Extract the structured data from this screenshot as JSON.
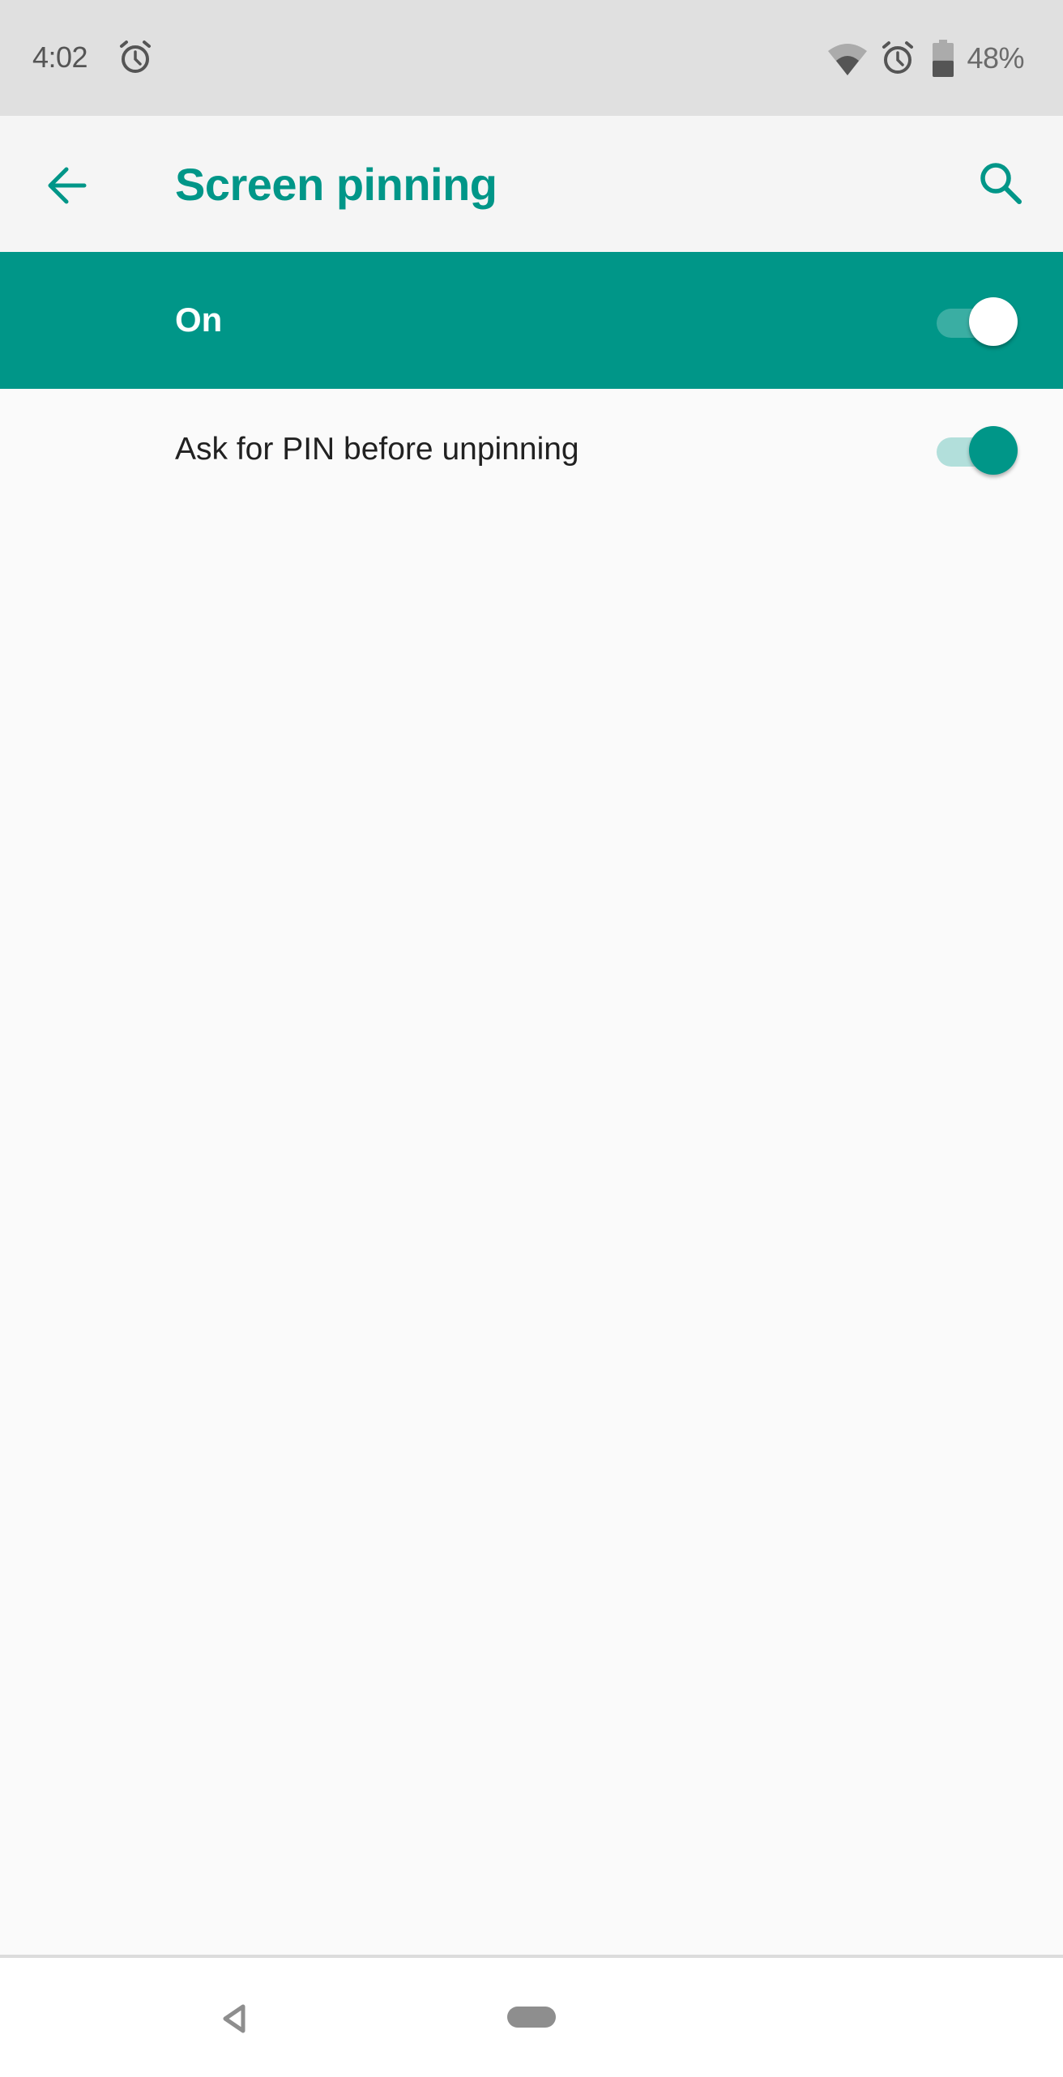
{
  "status_bar": {
    "time": "4:02",
    "left_icons": [
      "alarm-icon"
    ],
    "right_icons": [
      "wifi-icon",
      "alarm-icon",
      "battery-icon"
    ],
    "battery_percent": "48%",
    "battery_level": 0.48
  },
  "toolbar": {
    "back_icon": "arrow-left-icon",
    "title": "Screen pinning",
    "search_icon": "search-icon"
  },
  "master_switch": {
    "label": "On",
    "checked": true
  },
  "preferences": [
    {
      "label": "Ask for PIN before unpinning",
      "checked": true
    }
  ],
  "nav_bar": {
    "back_icon": "nav-back-icon",
    "home_icon": "nav-home-pill-icon"
  },
  "colors": {
    "accent": "#009688",
    "status_bar": "#e0e0e0",
    "toolbar": "#f5f5f5",
    "background": "#fafafa"
  }
}
